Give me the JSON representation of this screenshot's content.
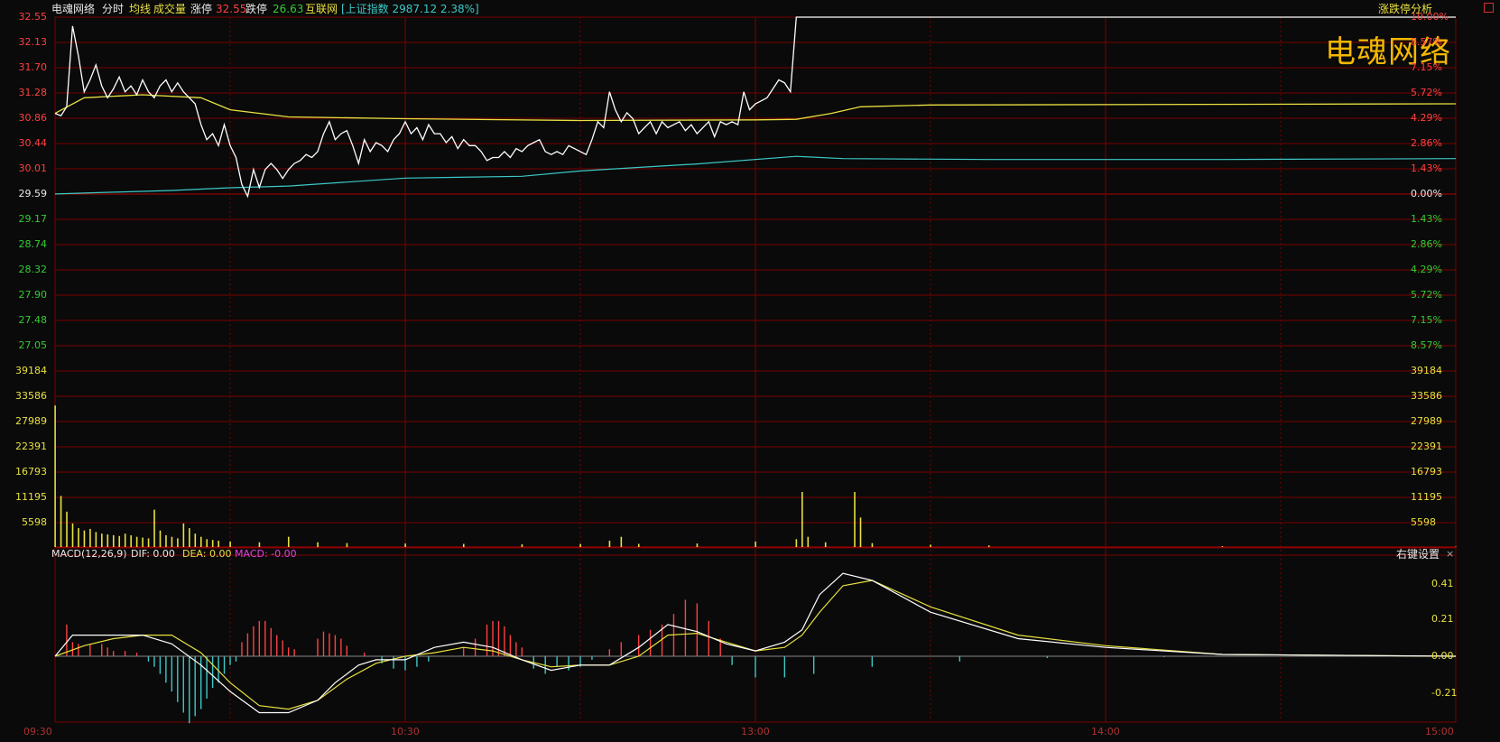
{
  "header": {
    "stock_name": "电魂网络",
    "mode": "分时",
    "avg_line_label": "均线",
    "volume_label": "成交量",
    "limit_up_label": "涨停",
    "limit_up_value": "32.55",
    "limit_down_label": "跌停",
    "limit_down_value": "26.63",
    "sector": "互联网",
    "index_text": "[上证指数 2987.12 2.38%]",
    "limit_analysis_link": "涨跌停分析",
    "watermark": "电魂网络"
  },
  "colors": {
    "grid": "#7a0000",
    "up": "#ff4040",
    "down": "#33cc33",
    "price_line": "#ffffff",
    "avg_line": "#e8e040",
    "index_line": "#3cc8c8",
    "volume_bar": "#e8e040",
    "macd_pos": "#ff4040",
    "macd_neg": "#3cc8c8",
    "dea": "#e8e040",
    "macd_label": "#e040e0"
  },
  "price_axis": {
    "left_labels": [
      "32.55",
      "32.13",
      "31.70",
      "31.28",
      "30.86",
      "30.44",
      "30.01",
      "29.59",
      "29.17",
      "28.74",
      "28.32",
      "27.90",
      "27.48",
      "27.05"
    ],
    "right_labels": [
      "10.00%",
      "8.57%",
      "7.15%",
      "5.72%",
      "4.29%",
      "2.86%",
      "1.43%",
      "0.00%",
      "1.43%",
      "2.86%",
      "4.29%",
      "5.72%",
      "7.15%",
      "8.57%"
    ],
    "prev_close": 29.59,
    "max": 32.55,
    "min": 26.63
  },
  "volume_axis": {
    "labels": [
      "39184",
      "33586",
      "27989",
      "22391",
      "16793",
      "11195",
      "5598"
    ],
    "max": 44782
  },
  "macd": {
    "title": "MACD(12,26,9)",
    "dif_text": "DIF: 0.00",
    "dea_text": "DEA: 0.00",
    "macd_text": "MACD: -0.00",
    "settings_label": "右键设置",
    "close_glyph": "×",
    "axis_labels": [
      "0.41",
      "0.21",
      "0.00",
      "-0.21"
    ]
  },
  "time_axis": [
    "09:30",
    "10:30",
    "13:00",
    "14:00",
    "15:00"
  ],
  "chart_data": {
    "type": "line",
    "x_range": [
      "09:30",
      "15:00"
    ],
    "prev_close": 29.59,
    "price": [
      [
        0,
        30.94
      ],
      [
        1,
        30.9
      ],
      [
        2,
        31.05
      ],
      [
        3,
        32.4
      ],
      [
        4,
        31.9
      ],
      [
        5,
        31.3
      ],
      [
        6,
        31.5
      ],
      [
        7,
        31.75
      ],
      [
        8,
        31.4
      ],
      [
        9,
        31.2
      ],
      [
        10,
        31.35
      ],
      [
        11,
        31.55
      ],
      [
        12,
        31.3
      ],
      [
        13,
        31.4
      ],
      [
        14,
        31.25
      ],
      [
        15,
        31.5
      ],
      [
        16,
        31.3
      ],
      [
        17,
        31.2
      ],
      [
        18,
        31.4
      ],
      [
        19,
        31.5
      ],
      [
        20,
        31.3
      ],
      [
        21,
        31.45
      ],
      [
        22,
        31.3
      ],
      [
        23,
        31.2
      ],
      [
        24,
        31.1
      ],
      [
        25,
        30.75
      ],
      [
        26,
        30.5
      ],
      [
        27,
        30.6
      ],
      [
        28,
        30.4
      ],
      [
        29,
        30.75
      ],
      [
        30,
        30.4
      ],
      [
        31,
        30.2
      ],
      [
        32,
        29.75
      ],
      [
        33,
        29.55
      ],
      [
        34,
        30.0
      ],
      [
        35,
        29.7
      ],
      [
        36,
        30.0
      ],
      [
        37,
        30.1
      ],
      [
        38,
        30.0
      ],
      [
        39,
        29.85
      ],
      [
        40,
        30.0
      ],
      [
        41,
        30.1
      ],
      [
        42,
        30.15
      ],
      [
        43,
        30.25
      ],
      [
        44,
        30.2
      ],
      [
        45,
        30.3
      ],
      [
        46,
        30.6
      ],
      [
        47,
        30.8
      ],
      [
        48,
        30.5
      ],
      [
        49,
        30.6
      ],
      [
        50,
        30.65
      ],
      [
        51,
        30.4
      ],
      [
        52,
        30.1
      ],
      [
        53,
        30.5
      ],
      [
        54,
        30.3
      ],
      [
        55,
        30.45
      ],
      [
        56,
        30.4
      ],
      [
        57,
        30.3
      ],
      [
        58,
        30.5
      ],
      [
        59,
        30.6
      ],
      [
        60,
        30.8
      ],
      [
        61,
        30.6
      ],
      [
        62,
        30.7
      ],
      [
        63,
        30.5
      ],
      [
        64,
        30.75
      ],
      [
        65,
        30.6
      ],
      [
        66,
        30.6
      ],
      [
        67,
        30.45
      ],
      [
        68,
        30.55
      ],
      [
        69,
        30.35
      ],
      [
        70,
        30.5
      ],
      [
        71,
        30.4
      ],
      [
        72,
        30.4
      ],
      [
        73,
        30.3
      ],
      [
        74,
        30.15
      ],
      [
        75,
        30.2
      ],
      [
        76,
        30.2
      ],
      [
        77,
        30.3
      ],
      [
        78,
        30.2
      ],
      [
        79,
        30.35
      ],
      [
        80,
        30.3
      ],
      [
        81,
        30.4
      ],
      [
        82,
        30.45
      ],
      [
        83,
        30.5
      ],
      [
        84,
        30.3
      ],
      [
        85,
        30.25
      ],
      [
        86,
        30.3
      ],
      [
        87,
        30.25
      ],
      [
        88,
        30.4
      ],
      [
        89,
        30.35
      ],
      [
        90,
        30.3
      ],
      [
        91,
        30.25
      ],
      [
        92,
        30.5
      ],
      [
        93,
        30.8
      ],
      [
        94,
        30.7
      ],
      [
        95,
        31.3
      ],
      [
        96,
        31.0
      ],
      [
        97,
        30.8
      ],
      [
        98,
        30.95
      ],
      [
        99,
        30.85
      ],
      [
        100,
        30.6
      ],
      [
        101,
        30.7
      ],
      [
        102,
        30.8
      ],
      [
        103,
        30.6
      ],
      [
        104,
        30.8
      ],
      [
        105,
        30.7
      ],
      [
        106,
        30.75
      ],
      [
        107,
        30.8
      ],
      [
        108,
        30.65
      ],
      [
        109,
        30.75
      ],
      [
        110,
        30.6
      ],
      [
        111,
        30.7
      ],
      [
        112,
        30.8
      ],
      [
        113,
        30.55
      ],
      [
        114,
        30.8
      ],
      [
        115,
        30.75
      ],
      [
        116,
        30.8
      ],
      [
        117,
        30.75
      ],
      [
        118,
        31.3
      ],
      [
        119,
        31.0
      ],
      [
        120,
        31.1
      ],
      [
        121,
        31.15
      ],
      [
        122,
        31.2
      ],
      [
        123,
        31.35
      ],
      [
        124,
        31.5
      ],
      [
        125,
        31.45
      ],
      [
        126,
        31.3
      ],
      [
        127,
        32.55
      ],
      [
        240,
        32.55
      ]
    ],
    "avg": [
      [
        0,
        30.94
      ],
      [
        5,
        31.2
      ],
      [
        15,
        31.25
      ],
      [
        25,
        31.2
      ],
      [
        30,
        31.0
      ],
      [
        40,
        30.88
      ],
      [
        60,
        30.85
      ],
      [
        90,
        30.82
      ],
      [
        120,
        30.83
      ],
      [
        127,
        30.84
      ],
      [
        133,
        30.94
      ],
      [
        138,
        31.05
      ],
      [
        150,
        31.08
      ],
      [
        240,
        31.1
      ]
    ],
    "index_pct": [
      [
        0,
        0.0
      ],
      [
        10,
        0.1
      ],
      [
        20,
        0.2
      ],
      [
        30,
        0.35
      ],
      [
        40,
        0.45
      ],
      [
        60,
        0.9
      ],
      [
        80,
        1.0
      ],
      [
        90,
        1.3
      ],
      [
        110,
        1.7
      ],
      [
        127,
        2.13
      ],
      [
        135,
        2.0
      ],
      [
        160,
        1.95
      ],
      [
        200,
        1.95
      ],
      [
        240,
        2.0
      ]
    ],
    "volume": [
      [
        0,
        36000
      ],
      [
        1,
        13000
      ],
      [
        2,
        9000
      ],
      [
        3,
        6000
      ],
      [
        4,
        4800
      ],
      [
        5,
        4200
      ],
      [
        6,
        4600
      ],
      [
        7,
        3800
      ],
      [
        8,
        3400
      ],
      [
        9,
        3200
      ],
      [
        10,
        3000
      ],
      [
        11,
        2800
      ],
      [
        12,
        3400
      ],
      [
        13,
        3000
      ],
      [
        14,
        2600
      ],
      [
        15,
        2400
      ],
      [
        16,
        2200
      ],
      [
        17,
        9500
      ],
      [
        18,
        4200
      ],
      [
        19,
        3000
      ],
      [
        20,
        2600
      ],
      [
        21,
        2200
      ],
      [
        22,
        6000
      ],
      [
        23,
        4800
      ],
      [
        24,
        3400
      ],
      [
        25,
        2600
      ],
      [
        26,
        2000
      ],
      [
        27,
        1800
      ],
      [
        28,
        1600
      ],
      [
        30,
        1400
      ],
      [
        35,
        1200
      ],
      [
        40,
        2600
      ],
      [
        45,
        1200
      ],
      [
        50,
        1000
      ],
      [
        60,
        900
      ],
      [
        70,
        800
      ],
      [
        80,
        700
      ],
      [
        90,
        800
      ],
      [
        95,
        1600
      ],
      [
        97,
        2600
      ],
      [
        100,
        800
      ],
      [
        110,
        900
      ],
      [
        120,
        1400
      ],
      [
        127,
        2000
      ],
      [
        128,
        14000
      ],
      [
        129,
        2600
      ],
      [
        132,
        1200
      ],
      [
        137,
        14000
      ],
      [
        138,
        7500
      ],
      [
        140,
        1000
      ],
      [
        150,
        600
      ],
      [
        160,
        400
      ],
      [
        200,
        200
      ],
      [
        240,
        100
      ]
    ],
    "macd_dif": [
      [
        0,
        0.0
      ],
      [
        3,
        0.12
      ],
      [
        10,
        0.12
      ],
      [
        15,
        0.12
      ],
      [
        20,
        0.07
      ],
      [
        25,
        -0.05
      ],
      [
        30,
        -0.2
      ],
      [
        35,
        -0.32
      ],
      [
        40,
        -0.32
      ],
      [
        45,
        -0.25
      ],
      [
        48,
        -0.15
      ],
      [
        52,
        -0.05
      ],
      [
        55,
        -0.02
      ],
      [
        60,
        -0.02
      ],
      [
        65,
        0.05
      ],
      [
        70,
        0.08
      ],
      [
        75,
        0.05
      ],
      [
        80,
        -0.02
      ],
      [
        85,
        -0.08
      ],
      [
        90,
        -0.05
      ],
      [
        95,
        -0.05
      ],
      [
        100,
        0.05
      ],
      [
        105,
        0.18
      ],
      [
        110,
        0.14
      ],
      [
        115,
        0.07
      ],
      [
        120,
        0.03
      ],
      [
        125,
        0.08
      ],
      [
        128,
        0.15
      ],
      [
        131,
        0.35
      ],
      [
        135,
        0.47
      ],
      [
        140,
        0.43
      ],
      [
        150,
        0.25
      ],
      [
        165,
        0.1
      ],
      [
        180,
        0.05
      ],
      [
        200,
        0.01
      ],
      [
        240,
        0.0
      ]
    ],
    "macd_dea": [
      [
        0,
        0.0
      ],
      [
        5,
        0.06
      ],
      [
        10,
        0.1
      ],
      [
        15,
        0.12
      ],
      [
        20,
        0.12
      ],
      [
        25,
        0.02
      ],
      [
        30,
        -0.15
      ],
      [
        35,
        -0.28
      ],
      [
        40,
        -0.3
      ],
      [
        45,
        -0.25
      ],
      [
        50,
        -0.13
      ],
      [
        55,
        -0.04
      ],
      [
        60,
        0.0
      ],
      [
        65,
        0.02
      ],
      [
        70,
        0.05
      ],
      [
        75,
        0.03
      ],
      [
        80,
        -0.02
      ],
      [
        85,
        -0.06
      ],
      [
        90,
        -0.05
      ],
      [
        95,
        -0.05
      ],
      [
        100,
        0.0
      ],
      [
        105,
        0.12
      ],
      [
        110,
        0.13
      ],
      [
        115,
        0.08
      ],
      [
        120,
        0.03
      ],
      [
        125,
        0.05
      ],
      [
        128,
        0.12
      ],
      [
        131,
        0.25
      ],
      [
        135,
        0.4
      ],
      [
        140,
        0.43
      ],
      [
        150,
        0.28
      ],
      [
        165,
        0.12
      ],
      [
        180,
        0.06
      ],
      [
        200,
        0.01
      ],
      [
        240,
        0.0
      ]
    ],
    "macd_hist": [
      [
        2,
        0.18
      ],
      [
        3,
        0.08
      ],
      [
        4,
        0.07
      ],
      [
        6,
        0.07
      ],
      [
        8,
        0.07
      ],
      [
        9,
        0.05
      ],
      [
        10,
        0.03
      ],
      [
        12,
        0.03
      ],
      [
        14,
        0.02
      ],
      [
        16,
        -0.03
      ],
      [
        17,
        -0.06
      ],
      [
        18,
        -0.1
      ],
      [
        19,
        -0.15
      ],
      [
        20,
        -0.2
      ],
      [
        21,
        -0.26
      ],
      [
        22,
        -0.32
      ],
      [
        23,
        -0.38
      ],
      [
        24,
        -0.34
      ],
      [
        25,
        -0.3
      ],
      [
        26,
        -0.24
      ],
      [
        27,
        -0.18
      ],
      [
        28,
        -0.15
      ],
      [
        29,
        -0.1
      ],
      [
        30,
        -0.05
      ],
      [
        31,
        -0.03
      ],
      [
        32,
        0.08
      ],
      [
        33,
        0.13
      ],
      [
        34,
        0.17
      ],
      [
        35,
        0.2
      ],
      [
        36,
        0.2
      ],
      [
        37,
        0.16
      ],
      [
        38,
        0.12
      ],
      [
        39,
        0.09
      ],
      [
        40,
        0.05
      ],
      [
        41,
        0.04
      ],
      [
        45,
        0.1
      ],
      [
        46,
        0.14
      ],
      [
        47,
        0.13
      ],
      [
        48,
        0.12
      ],
      [
        49,
        0.1
      ],
      [
        50,
        0.06
      ],
      [
        53,
        0.02
      ],
      [
        56,
        -0.04
      ],
      [
        58,
        -0.07
      ],
      [
        60,
        -0.08
      ],
      [
        62,
        -0.06
      ],
      [
        64,
        -0.03
      ],
      [
        70,
        0.05
      ],
      [
        72,
        0.1
      ],
      [
        74,
        0.18
      ],
      [
        75,
        0.2
      ],
      [
        76,
        0.2
      ],
      [
        77,
        0.17
      ],
      [
        78,
        0.12
      ],
      [
        79,
        0.08
      ],
      [
        80,
        0.05
      ],
      [
        82,
        -0.07
      ],
      [
        84,
        -0.1
      ],
      [
        86,
        -0.06
      ],
      [
        88,
        -0.08
      ],
      [
        90,
        -0.06
      ],
      [
        92,
        -0.02
      ],
      [
        95,
        0.04
      ],
      [
        97,
        0.08
      ],
      [
        100,
        0.12
      ],
      [
        102,
        0.15
      ],
      [
        104,
        0.18
      ],
      [
        106,
        0.24
      ],
      [
        108,
        0.32
      ],
      [
        110,
        0.3
      ],
      [
        112,
        0.2
      ],
      [
        114,
        0.1
      ],
      [
        116,
        -0.05
      ],
      [
        120,
        -0.12
      ],
      [
        125,
        -0.12
      ],
      [
        130,
        -0.1
      ],
      [
        140,
        -0.06
      ],
      [
        155,
        -0.03
      ],
      [
        170,
        -0.01
      ],
      [
        190,
        -0.005
      ],
      [
        240,
        0.0
      ]
    ]
  }
}
